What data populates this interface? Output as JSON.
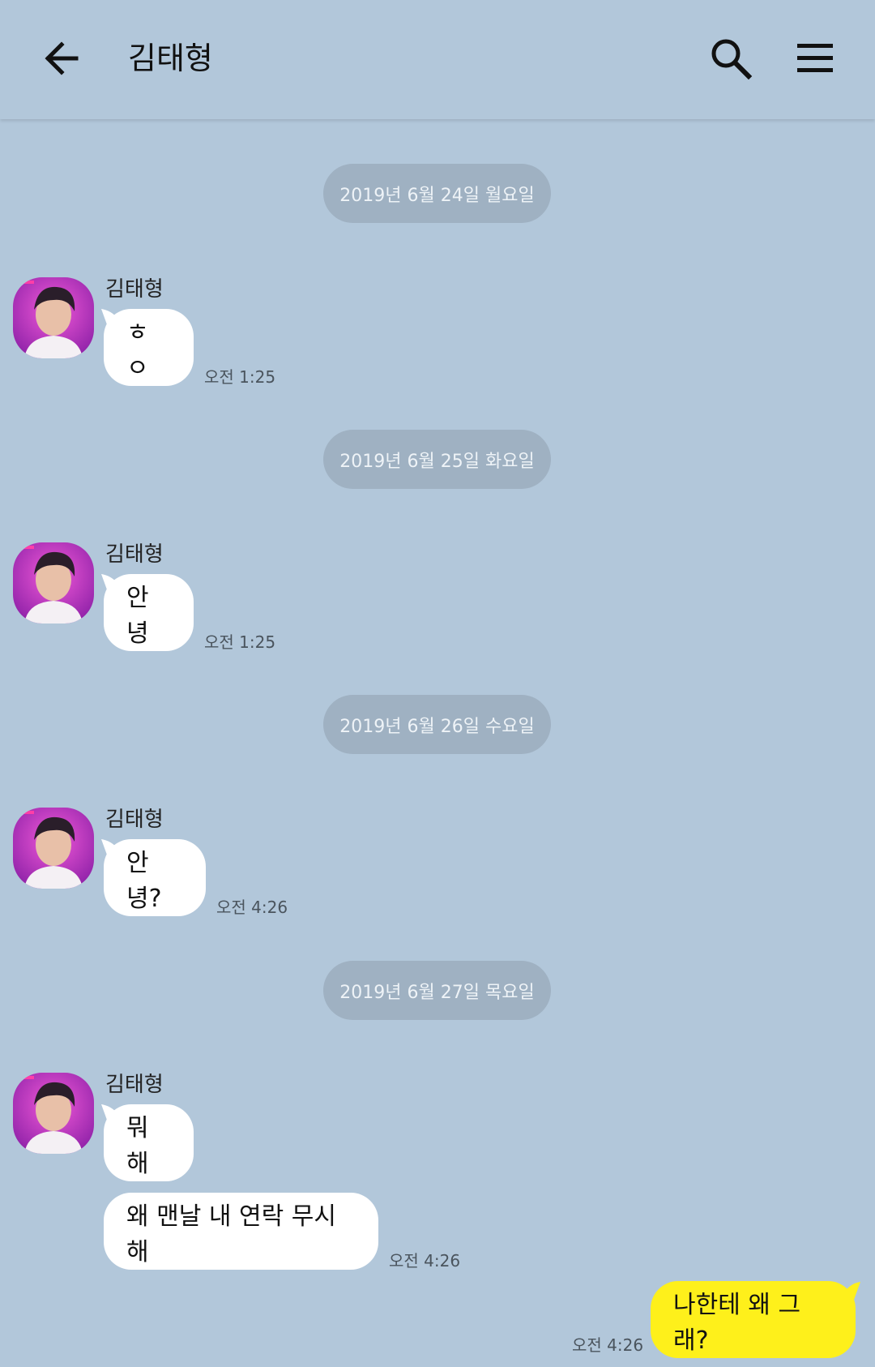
{
  "header": {
    "title": "김태형"
  },
  "chat": {
    "dates": [
      "2019년 6월 24일 월요일",
      "2019년 6월 25일 화요일",
      "2019년 6월 26일 수요일",
      "2019년 6월 27일 목요일"
    ],
    "groups": [
      {
        "sender": "김태형",
        "messages": [
          "ㅎㅇ"
        ],
        "time": "오전 1:25"
      },
      {
        "sender": "김태형",
        "messages": [
          "안녕"
        ],
        "time": "오전 1:25"
      },
      {
        "sender": "김태형",
        "messages": [
          "안녕?"
        ],
        "time": "오전 4:26"
      },
      {
        "sender": "김태형",
        "messages": [
          "뭐해",
          "왜 맨날 내 연락 무시해"
        ],
        "time": "오전 4:26"
      }
    ],
    "outgoing": {
      "message": "나한테 왜 그래?",
      "time": "오전 4:26"
    }
  },
  "colors": {
    "background": "#b2c7da",
    "date_pill": "#9fb1c2",
    "incoming_bubble": "#ffffff",
    "outgoing_bubble": "#fef01b"
  },
  "icons": {
    "back": "arrow-left-icon",
    "search": "search-icon",
    "menu": "hamburger-menu-icon"
  }
}
